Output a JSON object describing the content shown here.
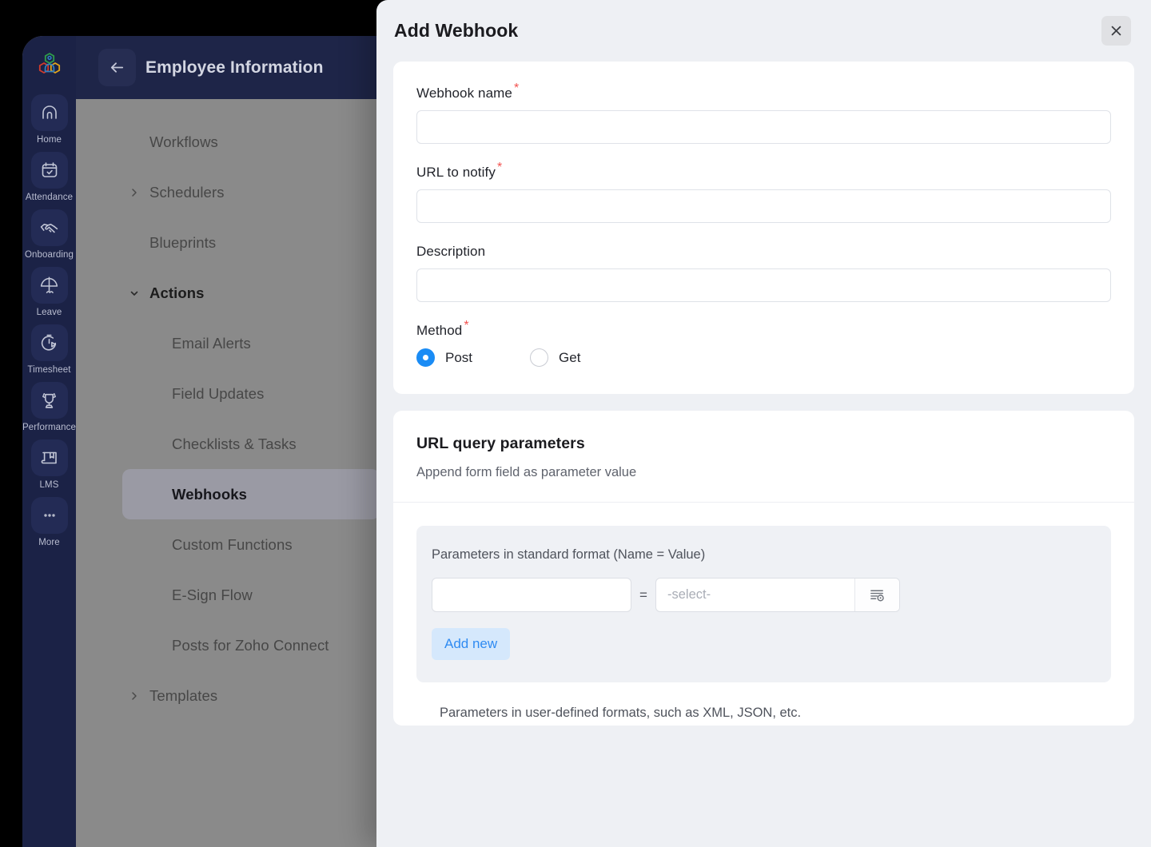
{
  "sidebar": {
    "logo_icon": "zoho-people-hexagon-logo",
    "items": [
      {
        "label": "Home",
        "icon": "home-icon"
      },
      {
        "label": "Attendance",
        "icon": "calendar-check-icon"
      },
      {
        "label": "Onboarding",
        "icon": "handshake-icon"
      },
      {
        "label": "Leave",
        "icon": "beach-umbrella-icon"
      },
      {
        "label": "Timesheet",
        "icon": "stopwatch-play-icon"
      },
      {
        "label": "Performance",
        "icon": "trophy-icon"
      },
      {
        "label": "LMS",
        "icon": "book-bookmark-icon"
      },
      {
        "label": "More",
        "icon": "ellipsis-icon"
      }
    ]
  },
  "nav": {
    "title": "Employee Information",
    "back_icon": "arrow-left-icon",
    "items": [
      {
        "label": "Workflows",
        "level": 0,
        "caret": "",
        "active": false,
        "section": false
      },
      {
        "label": "Schedulers",
        "level": 0,
        "caret": "right",
        "active": false,
        "section": false
      },
      {
        "label": "Blueprints",
        "level": 0,
        "caret": "",
        "active": false,
        "section": false
      },
      {
        "label": "Actions",
        "level": 0,
        "caret": "down",
        "active": false,
        "section": true
      },
      {
        "label": "Email Alerts",
        "level": 1,
        "caret": "",
        "active": false,
        "section": false
      },
      {
        "label": "Field Updates",
        "level": 1,
        "caret": "",
        "active": false,
        "section": false
      },
      {
        "label": "Checklists & Tasks",
        "level": 1,
        "caret": "",
        "active": false,
        "section": false
      },
      {
        "label": "Webhooks",
        "level": 1,
        "caret": "",
        "active": true,
        "section": false
      },
      {
        "label": "Custom Functions",
        "level": 1,
        "caret": "",
        "active": false,
        "section": false
      },
      {
        "label": "E-Sign Flow",
        "level": 1,
        "caret": "",
        "active": false,
        "section": false
      },
      {
        "label": "Posts for Zoho Connect",
        "level": 1,
        "caret": "",
        "active": false,
        "section": false
      },
      {
        "label": "Templates",
        "level": 0,
        "caret": "right",
        "active": false,
        "section": false
      }
    ]
  },
  "modal": {
    "title": "Add Webhook",
    "close_icon": "close-icon",
    "form": {
      "webhook_name": {
        "label": "Webhook name",
        "required": "*",
        "value": "",
        "placeholder": ""
      },
      "url_to_notify": {
        "label": "URL to notify",
        "required": "*",
        "value": "",
        "placeholder": ""
      },
      "description": {
        "label": "Description",
        "required": "",
        "value": "",
        "placeholder": ""
      },
      "method": {
        "label": "Method",
        "required": "*",
        "selected": "Post",
        "options": [
          "Post",
          "Get"
        ]
      }
    },
    "query_params": {
      "title": "URL query parameters",
      "subtitle": "Append form field as parameter value",
      "standard_title": "Parameters in standard format (Name = Value)",
      "param_name_value": "",
      "param_name_placeholder": "",
      "equals": "=",
      "param_value_value": "",
      "param_value_placeholder": "-select-",
      "picker_icon": "field-list-picker-icon",
      "add_new_label": "Add new",
      "user_defined_text": "Parameters in user-defined formats, such as XML, JSON, etc."
    }
  },
  "colors": {
    "sidebar_bg": "#1b2246",
    "nav_header_bg": "#1e2548",
    "accent_blue": "#1a8cf5",
    "required_red": "#f2524f",
    "add_new_bg": "#d5e8fc",
    "add_new_text": "#2f8bf2"
  }
}
